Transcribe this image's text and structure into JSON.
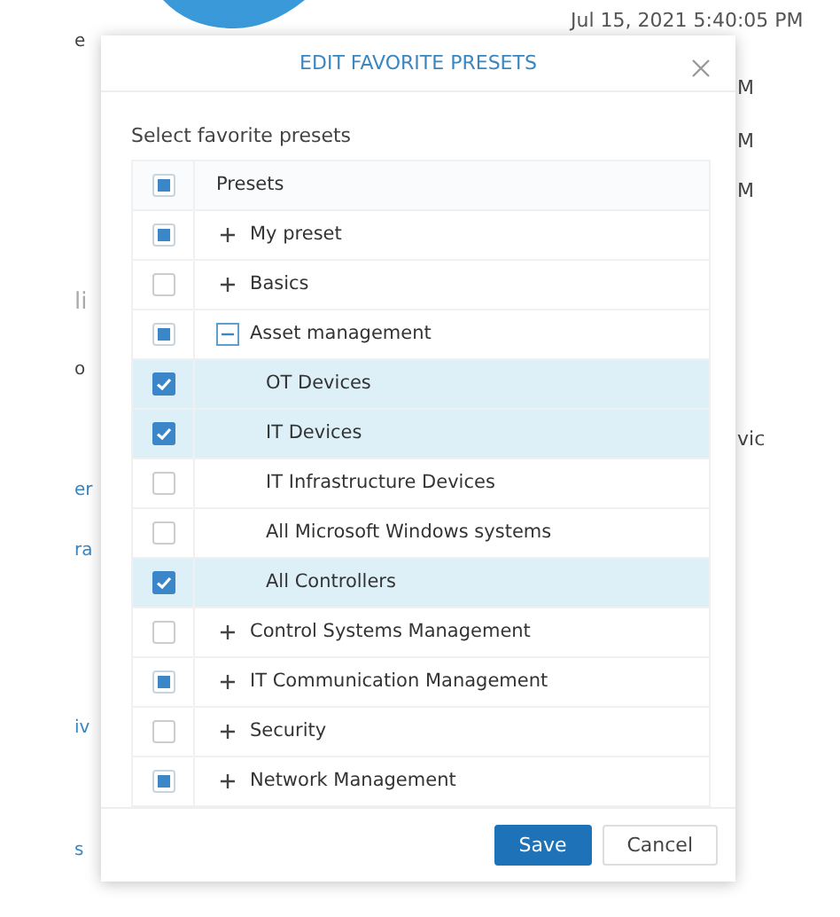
{
  "background": {
    "timestamp": "Jul 15, 2021 5:40:05 PM",
    "left_fragments": [
      {
        "text": "e",
        "kind": "plain"
      },
      {
        "text": "li",
        "kind": "muted"
      },
      {
        "text": "o",
        "kind": "plain"
      },
      {
        "text": "er",
        "kind": "link"
      },
      {
        "text": "ra",
        "kind": "link"
      },
      {
        "text": "iv",
        "kind": "link"
      },
      {
        "text": "s",
        "kind": "link"
      }
    ],
    "right_fragments": [
      {
        "text": "M"
      },
      {
        "text": "M"
      },
      {
        "text": "M"
      },
      {
        "text": "vic"
      }
    ]
  },
  "dialog": {
    "title": "EDIT FAVORITE PRESETS",
    "label": "Select favorite presets",
    "header": {
      "label": "Presets",
      "checked": false,
      "indeterminate": true
    },
    "rows": [
      {
        "label": "My preset",
        "checked": false,
        "indeterminate": true,
        "expanded": false,
        "selected": false
      },
      {
        "label": "Basics",
        "checked": false,
        "indeterminate": false,
        "expanded": false,
        "selected": false
      },
      {
        "label": "Asset management",
        "checked": false,
        "indeterminate": true,
        "expanded": true,
        "selected": false,
        "children": [
          {
            "label": "OT Devices",
            "checked": true,
            "selected": true
          },
          {
            "label": "IT Devices",
            "checked": true,
            "selected": true
          },
          {
            "label": "IT Infrastructure Devices",
            "checked": false,
            "indeterminate": false,
            "selected": false
          },
          {
            "label": "All Microsoft Windows systems",
            "checked": false,
            "indeterminate": false,
            "selected": false
          },
          {
            "label": "All Controllers",
            "checked": true,
            "selected": true
          }
        ]
      },
      {
        "label": "Control Systems Management",
        "checked": false,
        "indeterminate": false,
        "expanded": false,
        "selected": false
      },
      {
        "label": "IT Communication Management",
        "checked": false,
        "indeterminate": true,
        "expanded": false,
        "selected": false
      },
      {
        "label": "Security",
        "checked": false,
        "indeterminate": false,
        "expanded": false,
        "selected": false
      },
      {
        "label": "Network Management",
        "checked": false,
        "indeterminate": true,
        "expanded": false,
        "selected": false
      }
    ],
    "buttons": [
      {
        "label": "Save",
        "kind": "primary"
      },
      {
        "label": "Cancel",
        "kind": "secondary"
      }
    ]
  }
}
